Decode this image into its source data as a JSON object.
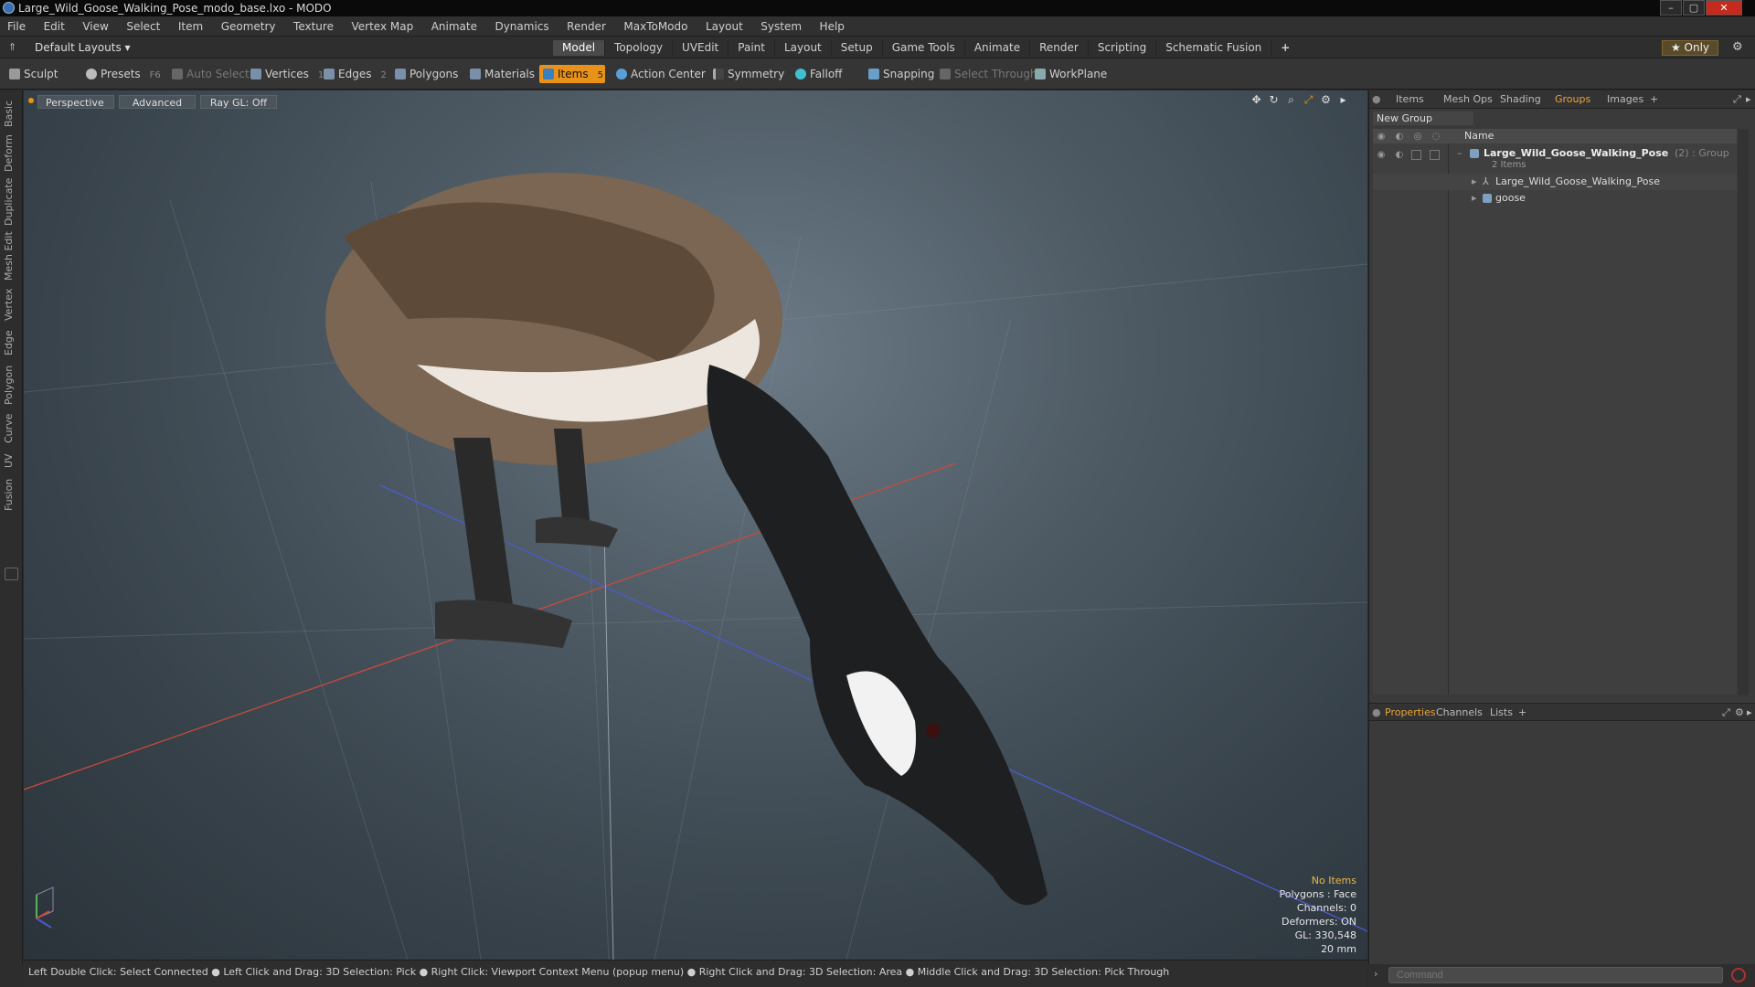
{
  "window": {
    "title": "Large_Wild_Goose_Walking_Pose_modo_base.lxo - MODO",
    "controls": [
      "–",
      "▢",
      "✕"
    ]
  },
  "menubar": [
    "File",
    "Edit",
    "View",
    "Select",
    "Item",
    "Geometry",
    "Texture",
    "Vertex Map",
    "Animate",
    "Dynamics",
    "Render",
    "MaxToModo",
    "Layout",
    "System",
    "Help"
  ],
  "layouts": {
    "dropdown": "Default Layouts ▾",
    "tabs": [
      "Model",
      "Topology",
      "UVEdit",
      "Paint",
      "Layout",
      "Setup",
      "Game Tools",
      "Animate",
      "Render",
      "Scripting",
      "Schematic Fusion"
    ],
    "active_tab": "Model",
    "add": "+",
    "only": "★ Only"
  },
  "toolbar": {
    "sculpt": "Sculpt",
    "presets": "Presets",
    "presets_key": "F6",
    "auto_select": "Auto Select",
    "vertices": "Vertices",
    "vertices_count": "1",
    "edges": "Edges",
    "edges_count": "2",
    "polygons": "Polygons",
    "materials": "Materials",
    "items": "Items",
    "items_count": "5",
    "action_center": "Action Center",
    "symmetry": "Symmetry",
    "falloff": "Falloff",
    "snapping": "Snapping",
    "select_through": "Select Through",
    "workplane": "WorkPlane"
  },
  "left_tabs": [
    "Basic",
    "Deform",
    "Duplicate",
    "Mesh Edit",
    "Vertex",
    "Edge",
    "Polygon",
    "Curve",
    "UV",
    "Fusion"
  ],
  "viewport": {
    "perspective": "Perspective",
    "advanced": "Advanced",
    "raygl": "Ray GL: Off",
    "hud": {
      "no_items": "No Items",
      "polygons": "Polygons : Face",
      "channels": "Channels: 0",
      "deformers": "Deformers: ON",
      "gl": "GL: 330,548",
      "scale": "20 mm"
    }
  },
  "right_panel": {
    "tabs": [
      "Items",
      "Mesh Ops",
      "Shading",
      "Groups",
      "Images",
      "+"
    ],
    "active_tab": "Groups",
    "new_group": "New Group",
    "column_name": "Name",
    "group_name": "Large_Wild_Goose_Walking_Pose",
    "group_suffix": "(2) : Group",
    "group_count": "2 Items",
    "children": [
      "Large_Wild_Goose_Walking_Pose",
      "goose"
    ],
    "bottom_tabs": [
      "Properties",
      "Channels",
      "Lists",
      "+"
    ],
    "bottom_active": "Properties"
  },
  "statusbar": {
    "hints": "Left Double Click: Select Connected ● Left Click and Drag: 3D Selection: Pick ● Right Click: Viewport Context Menu (popup menu) ● Right Click and Drag: 3D Selection: Area ● Middle Click and Drag: 3D Selection: Pick Through"
  },
  "command": {
    "placeholder": "Command"
  },
  "colors": {
    "accent": "#e8921a",
    "axis_x": "#c84a3a",
    "axis_z": "#4a5ad0"
  }
}
